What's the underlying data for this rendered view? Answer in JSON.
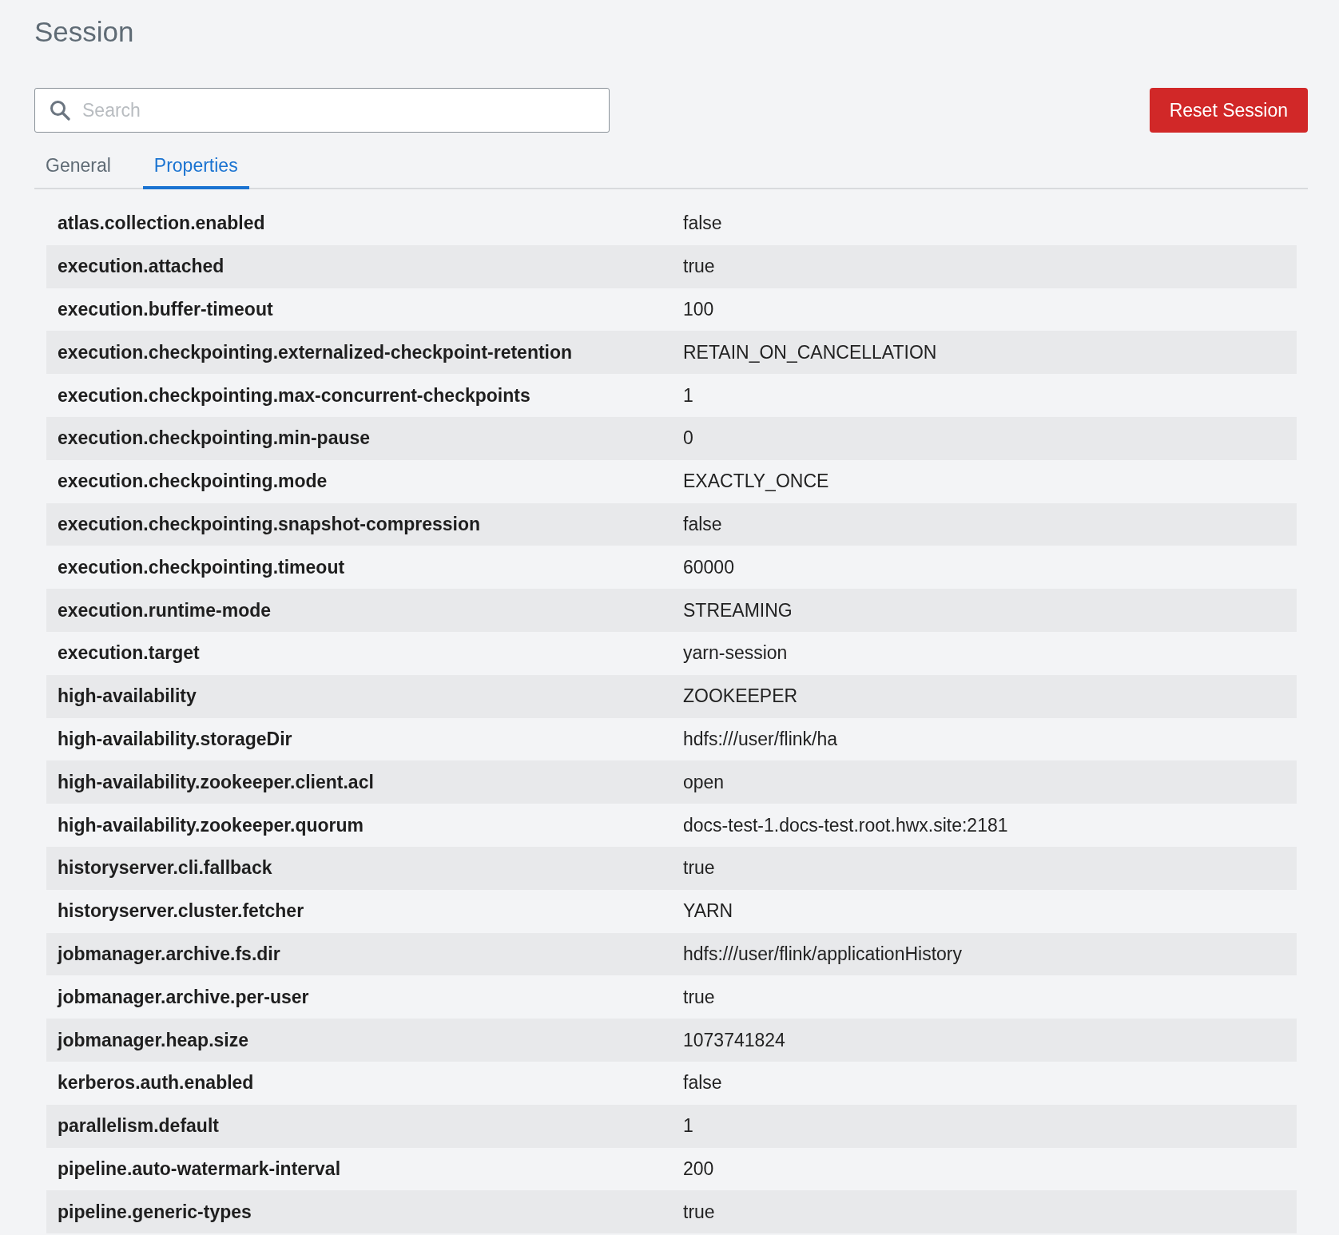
{
  "title": "Session",
  "search": {
    "placeholder": "Search"
  },
  "reset_button": "Reset Session",
  "tabs": [
    {
      "label": "General",
      "selected": false
    },
    {
      "label": "Properties",
      "selected": true
    }
  ],
  "properties": [
    {
      "key": "atlas.collection.enabled",
      "value": "false"
    },
    {
      "key": "execution.attached",
      "value": "true"
    },
    {
      "key": "execution.buffer-timeout",
      "value": "100"
    },
    {
      "key": "execution.checkpointing.externalized-checkpoint-retention",
      "value": "RETAIN_ON_CANCELLATION"
    },
    {
      "key": "execution.checkpointing.max-concurrent-checkpoints",
      "value": "1"
    },
    {
      "key": "execution.checkpointing.min-pause",
      "value": "0"
    },
    {
      "key": "execution.checkpointing.mode",
      "value": "EXACTLY_ONCE"
    },
    {
      "key": "execution.checkpointing.snapshot-compression",
      "value": "false"
    },
    {
      "key": "execution.checkpointing.timeout",
      "value": "60000"
    },
    {
      "key": "execution.runtime-mode",
      "value": "STREAMING"
    },
    {
      "key": "execution.target",
      "value": "yarn-session"
    },
    {
      "key": "high-availability",
      "value": "ZOOKEEPER"
    },
    {
      "key": "high-availability.storageDir",
      "value": "hdfs:///user/flink/ha"
    },
    {
      "key": "high-availability.zookeeper.client.acl",
      "value": "open"
    },
    {
      "key": "high-availability.zookeeper.quorum",
      "value": "docs-test-1.docs-test.root.hwx.site:2181"
    },
    {
      "key": "historyserver.cli.fallback",
      "value": "true"
    },
    {
      "key": "historyserver.cluster.fetcher",
      "value": "YARN"
    },
    {
      "key": "jobmanager.archive.fs.dir",
      "value": "hdfs:///user/flink/applicationHistory"
    },
    {
      "key": "jobmanager.archive.per-user",
      "value": "true"
    },
    {
      "key": "jobmanager.heap.size",
      "value": "1073741824"
    },
    {
      "key": "kerberos.auth.enabled",
      "value": "false"
    },
    {
      "key": "parallelism.default",
      "value": "1"
    },
    {
      "key": "pipeline.auto-watermark-interval",
      "value": "200"
    },
    {
      "key": "pipeline.generic-types",
      "value": "true"
    }
  ]
}
